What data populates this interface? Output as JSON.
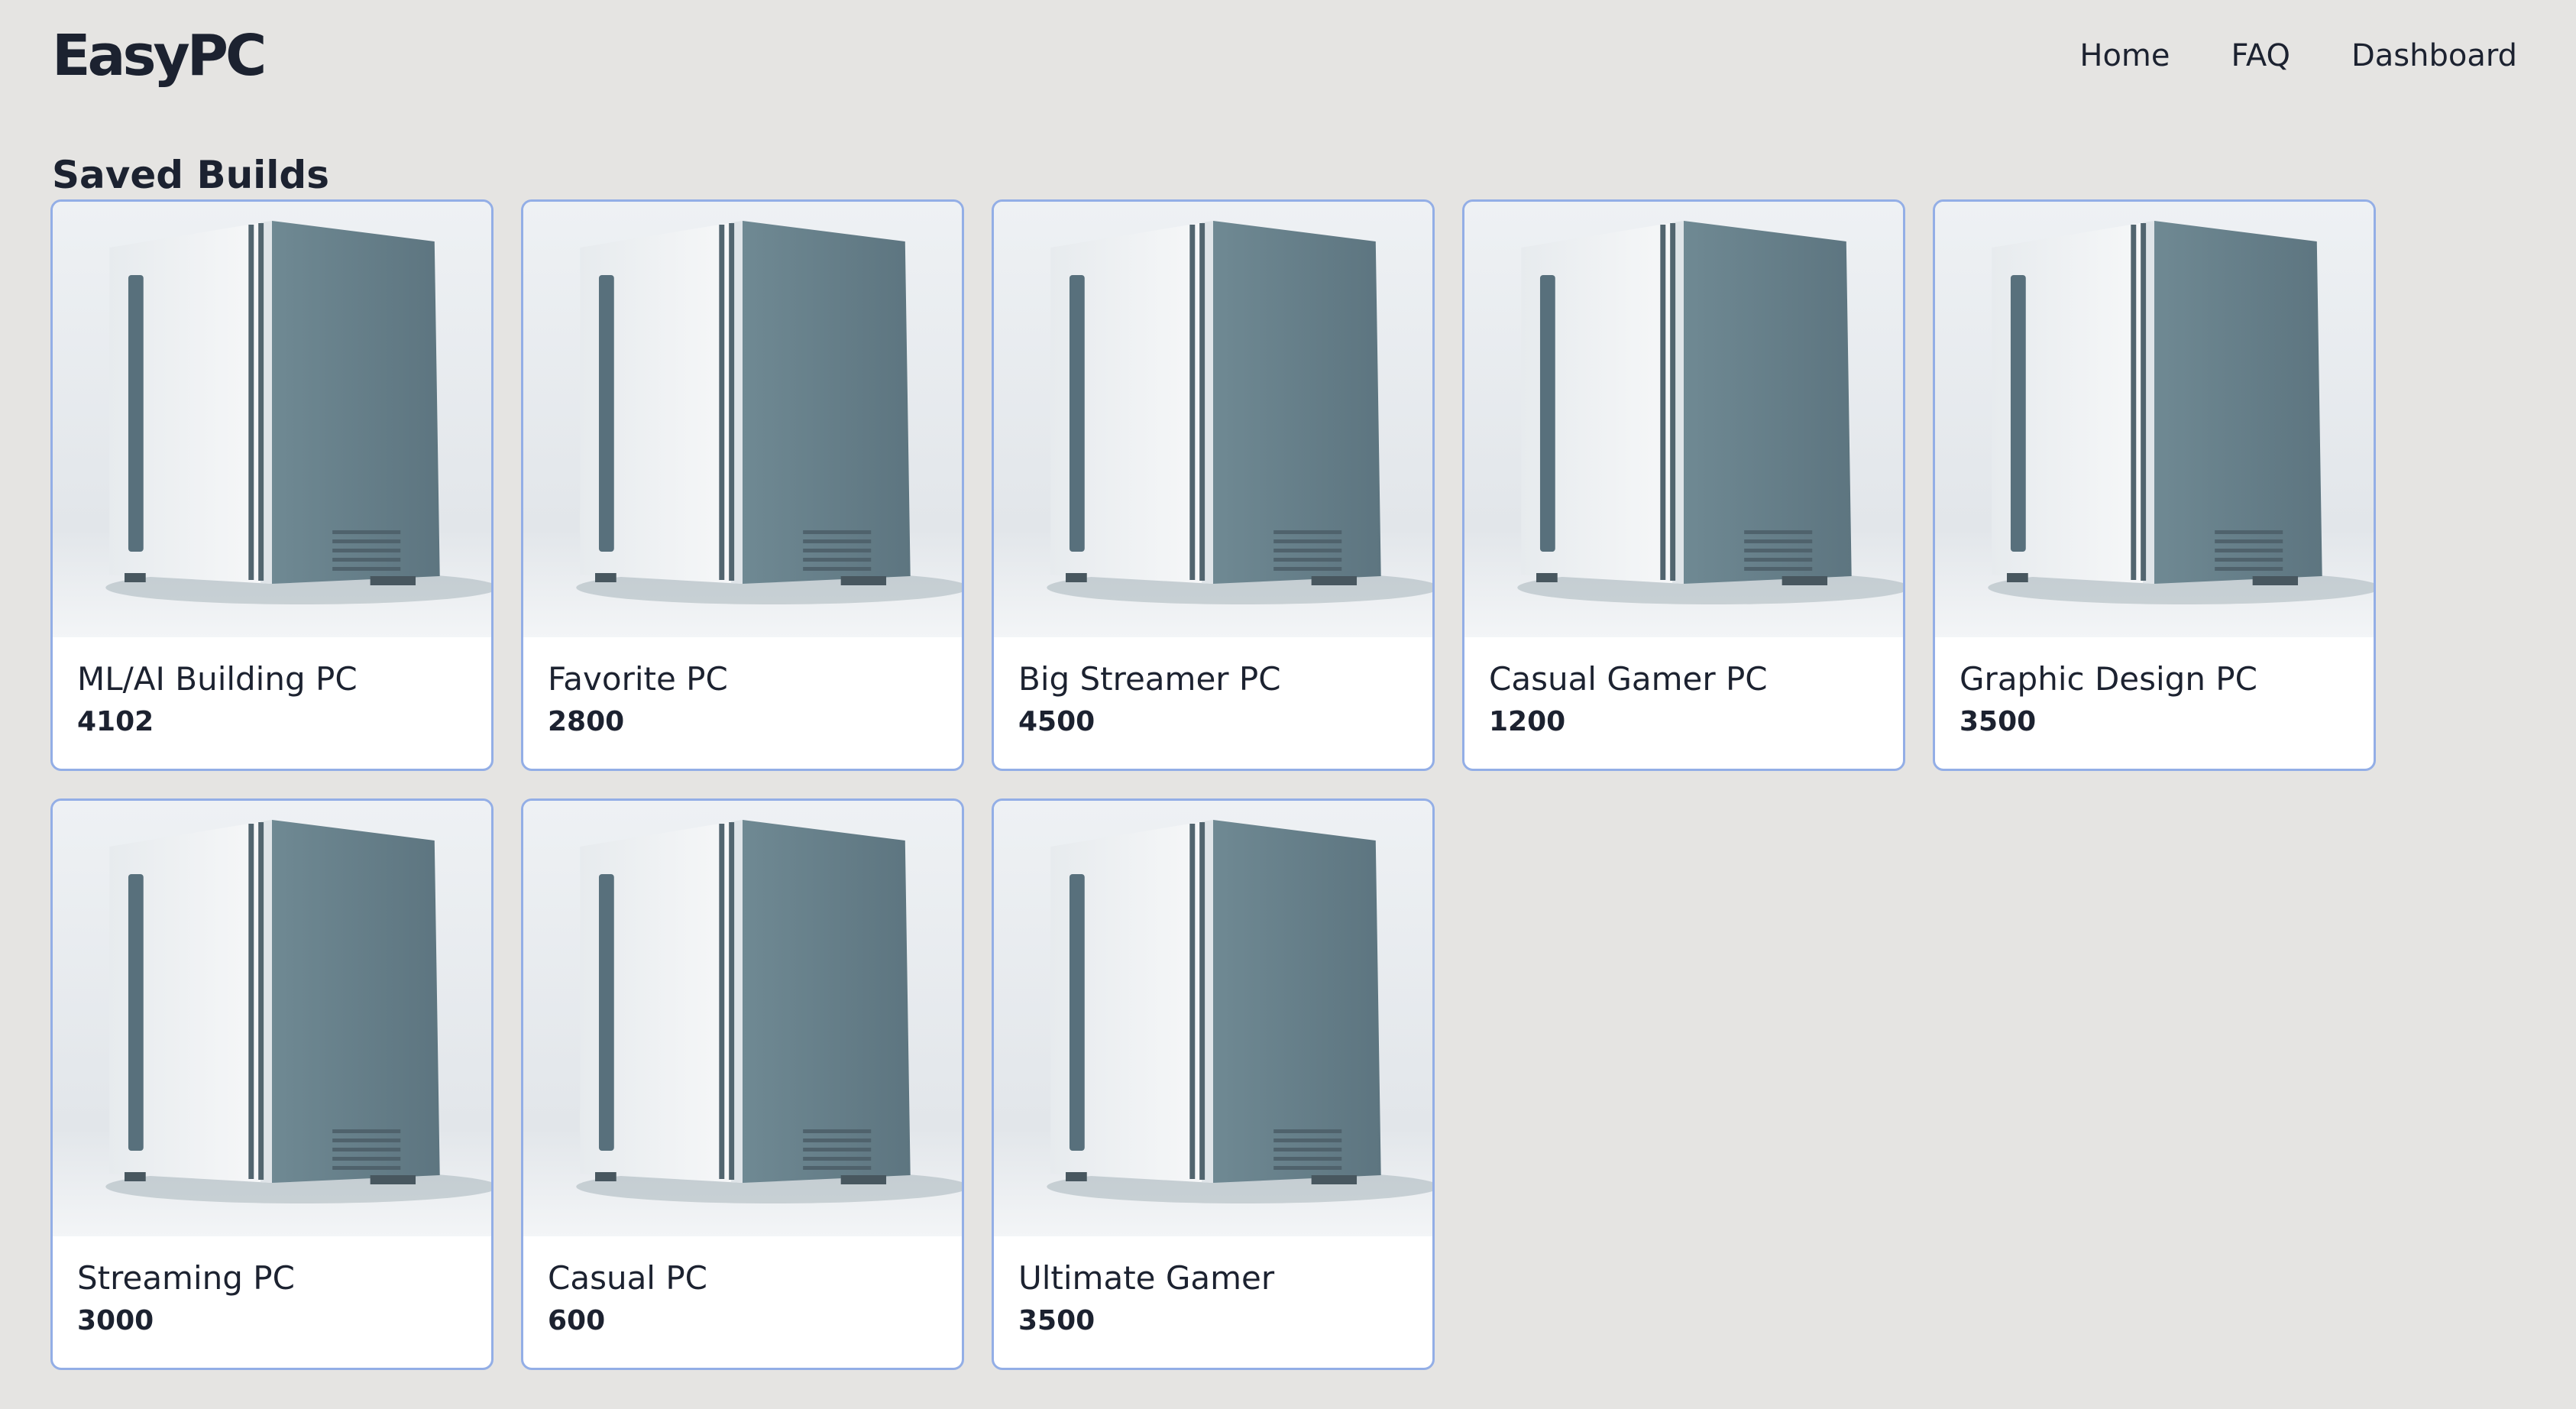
{
  "app": {
    "logo": "EasyPC"
  },
  "nav": {
    "items": [
      {
        "label": "Home"
      },
      {
        "label": "FAQ"
      },
      {
        "label": "Dashboard"
      }
    ]
  },
  "saved_builds": {
    "title": "Saved Builds",
    "builds": [
      {
        "name": "ML/AI Building PC",
        "price": "4102",
        "icon": "pc-case-image"
      },
      {
        "name": "Favorite PC",
        "price": "2800",
        "icon": "pc-case-image"
      },
      {
        "name": "Big Streamer PC",
        "price": "4500",
        "icon": "pc-case-image"
      },
      {
        "name": "Casual Gamer PC",
        "price": "1200",
        "icon": "pc-case-image"
      },
      {
        "name": "Graphic Design PC",
        "price": "3500",
        "icon": "pc-case-image"
      },
      {
        "name": "Streaming PC",
        "price": "3000",
        "icon": "pc-case-image"
      },
      {
        "name": "Casual PC",
        "price": "600",
        "icon": "pc-case-image"
      },
      {
        "name": "Ultimate Gamer",
        "price": "3500",
        "icon": "pc-case-image"
      }
    ]
  },
  "colors": {
    "background": "#e5e4e2",
    "card_border": "#93aee6",
    "text": "#1c2230"
  }
}
